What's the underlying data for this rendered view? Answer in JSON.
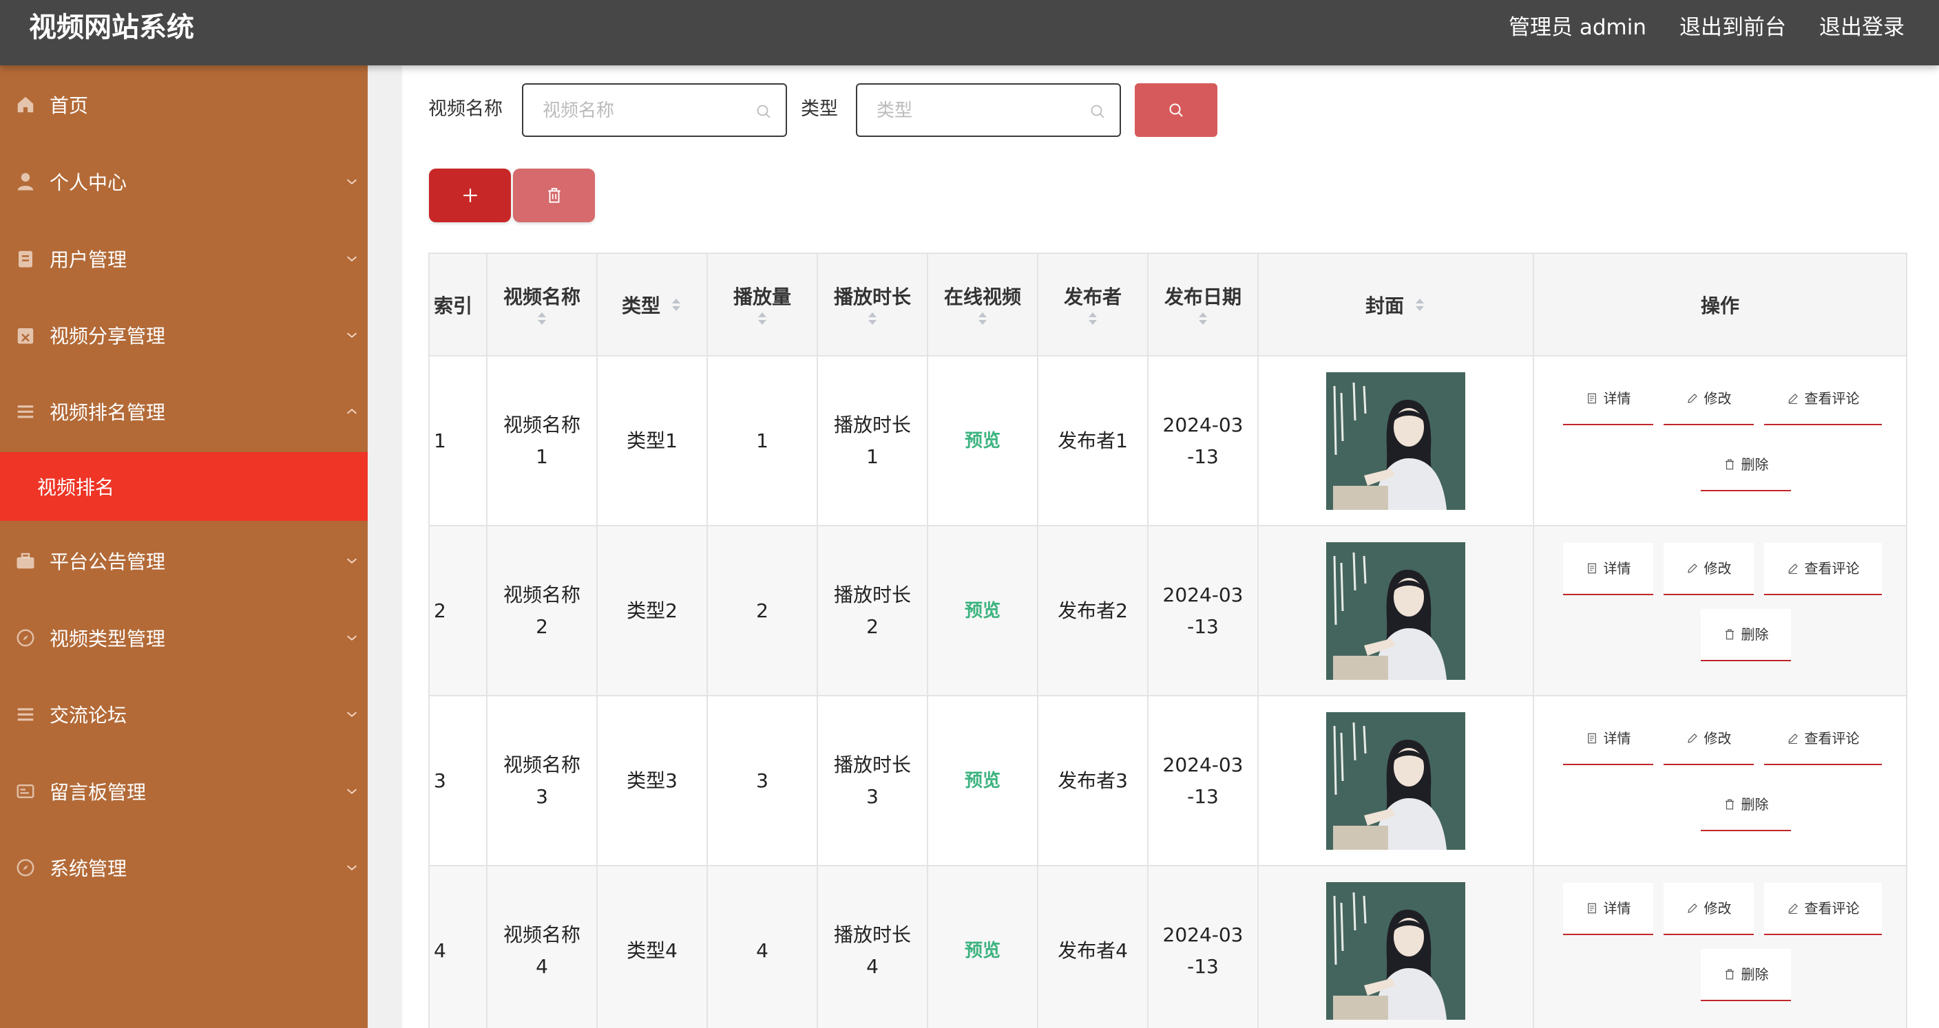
{
  "header": {
    "title": "视频网站系统",
    "links": [
      {
        "label": "管理员 admin"
      },
      {
        "label": "退出到前台"
      },
      {
        "label": "退出登录"
      }
    ]
  },
  "sidebar": {
    "items": [
      {
        "label": "首页",
        "icon": "home-icon"
      },
      {
        "label": "个人中心",
        "icon": "user-icon"
      },
      {
        "label": "用户管理",
        "icon": "clipboard-icon"
      },
      {
        "label": "视频分享管理",
        "icon": "calendar-icon"
      },
      {
        "label": "视频排名管理",
        "icon": "menu-icon"
      },
      {
        "label": "平台公告管理",
        "icon": "briefcase-icon"
      },
      {
        "label": "视频类型管理",
        "icon": "compass-icon"
      },
      {
        "label": "交流论坛",
        "icon": "menu-icon"
      },
      {
        "label": "留言板管理",
        "icon": "message-box-icon"
      },
      {
        "label": "系统管理",
        "icon": "compass-icon"
      }
    ],
    "active_subitem": "视频排名"
  },
  "search": {
    "name_label": "视频名称",
    "name_placeholder": "视频名称",
    "name_value": "",
    "type_label": "类型",
    "type_placeholder": "类型",
    "type_value": ""
  },
  "table": {
    "headers": {
      "index": "索引",
      "name": "视频名称",
      "type": "类型",
      "plays": "播放量",
      "duration": "播放时长",
      "online": "在线视频",
      "publisher": "发布者",
      "date": "发布日期",
      "cover": "封面",
      "actions": "操作"
    },
    "rows": [
      {
        "index": "1",
        "name": [
          "视频名称",
          "1"
        ],
        "type": "类型1",
        "plays": "1",
        "duration": [
          "播放时长",
          "1"
        ],
        "online": "预览",
        "publisher": "发布者1",
        "date": [
          "2024-03",
          "-13"
        ]
      },
      {
        "index": "2",
        "name": [
          "视频名称",
          "2"
        ],
        "type": "类型2",
        "plays": "2",
        "duration": [
          "播放时长",
          "2"
        ],
        "online": "预览",
        "publisher": "发布者2",
        "date": [
          "2024-03",
          "-13"
        ]
      },
      {
        "index": "3",
        "name": [
          "视频名称",
          "3"
        ],
        "type": "类型3",
        "plays": "3",
        "duration": [
          "播放时长",
          "3"
        ],
        "online": "预览",
        "publisher": "发布者3",
        "date": [
          "2024-03",
          "-13"
        ]
      },
      {
        "index": "4",
        "name": [
          "视频名称",
          "4"
        ],
        "type": "类型4",
        "plays": "4",
        "duration": [
          "播放时长",
          "4"
        ],
        "online": "预览",
        "publisher": "发布者4",
        "date": [
          "2024-03",
          "-13"
        ]
      }
    ],
    "actions": {
      "detail": "详情",
      "edit": "修改",
      "comments": "查看评论",
      "delete": "删除"
    }
  },
  "colors": {
    "topbar": "#474747",
    "sidebar": "#b36a37",
    "active_item": "#ee3526",
    "search_button": "#d65a5b",
    "add_button": "#c82727",
    "delete_button": "#d66a6c",
    "preview_link": "#3cb37f"
  }
}
